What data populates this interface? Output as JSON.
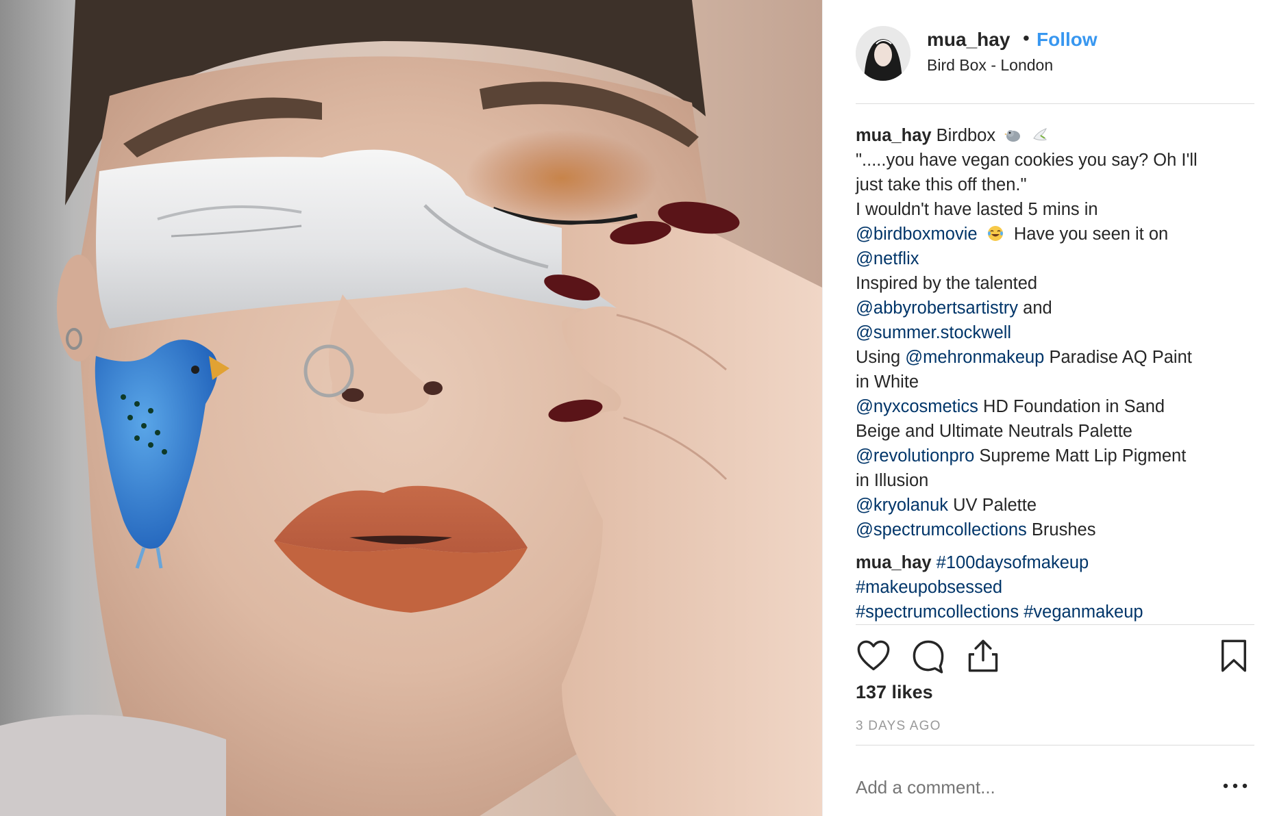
{
  "post": {
    "username": "mua_hay",
    "follow_label": "Follow",
    "separator": "•",
    "location": "Bird Box - London"
  },
  "caption": {
    "username": "mua_hay",
    "title": "Birdbox",
    "title_emojis": [
      "bird-emoji",
      "dove-emoji"
    ],
    "line2": "\".....you have vegan cookies you say? Oh I'll",
    "line3": "just take this off then.\"",
    "line4": "I wouldn't have lasted 5 mins in",
    "mention_birdbox": "@birdboxmovie",
    "line5_rest": "Have you seen it on",
    "mention_netflix": "@netflix",
    "line7": "Inspired by the talented",
    "mention_abby": "@abbyrobertsartistry",
    "line8_rest": "and",
    "mention_summer": "@summer.stockwell",
    "using": "Using",
    "mention_mehron": "@mehronmakeup",
    "line10_rest": "Paradise AQ Paint",
    "line11": "in White",
    "mention_nyx": "@nyxcosmetics",
    "line12_rest": "HD Foundation in Sand",
    "line13": "Beige and Ultimate Neutrals Palette",
    "mention_revolution": "@revolutionpro",
    "line14_rest": "Supreme Matt Lip Pigment",
    "line15": "in Illusion",
    "mention_kryolan": "@kryolanuk",
    "line16_rest": "UV Palette",
    "mention_spectrum": "@spectrumcollections",
    "line17_rest": "Brushes"
  },
  "comment": {
    "username": "mua_hay",
    "tag1": "#100daysofmakeup",
    "tag2": "#makeupobsessed",
    "tag3": "#spectrumcollections",
    "tag4": "#veganmakeup"
  },
  "actions": {
    "icons": [
      "heart-icon",
      "comment-icon",
      "share-icon",
      "bookmark-icon"
    ]
  },
  "likes": "137 likes",
  "timestamp": "3 DAYS AGO",
  "add_comment_placeholder": "Add a comment...",
  "colors": {
    "link_blue": "#3897f0",
    "mention_blue": "#003569",
    "text": "#262626",
    "muted": "#999999",
    "divider": "#dbdbdb"
  }
}
